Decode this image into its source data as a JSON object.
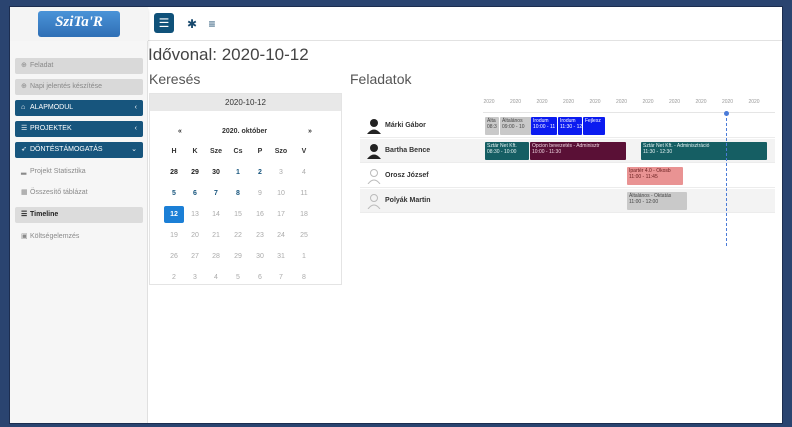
{
  "app": {
    "logo_text": "SziTa'R"
  },
  "sidebar": {
    "items": [
      {
        "label": "Feladat"
      },
      {
        "label": "Napi jelentés készítése"
      },
      {
        "label": "ALAPMODUL"
      },
      {
        "label": "PROJEKTEK"
      },
      {
        "label": "DÖNTÉSTÁMOGATÁS"
      },
      {
        "label": "Projekt Statisztika"
      },
      {
        "label": "Összesítő táblázat"
      },
      {
        "label": "Timeline"
      },
      {
        "label": "Költségelemzés"
      }
    ]
  },
  "page": {
    "title": "Idővonal: 2020-10-12",
    "search_heading": "Keresés",
    "tasks_heading": "Feladatok"
  },
  "calendar": {
    "selected_date": "2020-10-12",
    "prev": "«",
    "next": "»",
    "month_label": "2020. október",
    "weekdays": [
      "H",
      "K",
      "Sze",
      "Cs",
      "P",
      "Szo",
      "V"
    ],
    "weeks": [
      [
        "28",
        "29",
        "30",
        "1",
        "2",
        "3",
        "4"
      ],
      [
        "5",
        "6",
        "7",
        "8",
        "9",
        "10",
        "11"
      ],
      [
        "12",
        "13",
        "14",
        "15",
        "16",
        "17",
        "18"
      ],
      [
        "19",
        "20",
        "21",
        "22",
        "23",
        "24",
        "25"
      ],
      [
        "26",
        "27",
        "28",
        "29",
        "30",
        "31",
        "1"
      ],
      [
        "2",
        "3",
        "4",
        "5",
        "6",
        "7",
        "8"
      ]
    ]
  },
  "timeline": {
    "ticks": [
      "2020",
      "2020",
      "2020",
      "2020",
      "2020",
      "2020",
      "2020",
      "2020",
      "2020",
      "2020",
      "2020"
    ],
    "people": [
      {
        "name": "Márki Gábor"
      },
      {
        "name": "Bartha Bence"
      },
      {
        "name": "Orosz József"
      },
      {
        "name": "Polyák Martin"
      }
    ],
    "bars": [
      {
        "title": "Álta",
        "time": "08:3"
      },
      {
        "title": "Általános",
        "time": "09:00 - 10"
      },
      {
        "title": "Irodum",
        "time": "10:00 - 11"
      },
      {
        "title": "Irodum",
        "time": "11:30 - 12:30"
      },
      {
        "title": "Fejlesz",
        "time": ""
      },
      {
        "title": "Sztár Net Kft.",
        "time": "08:30 - 10:00"
      },
      {
        "title": "Opcion bevezetés - Adminisztr",
        "time": "10:00 - 11:30"
      },
      {
        "title": "Sztár Net Kft. - Adminisztráció",
        "time": "11:30 - 12:30"
      },
      {
        "title": "Ipartér 4.0 - Okosb",
        "time": "11:00 - 11:45"
      },
      {
        "title": "Általános - Oktatás",
        "time": "11:00 - 12:00"
      }
    ]
  }
}
